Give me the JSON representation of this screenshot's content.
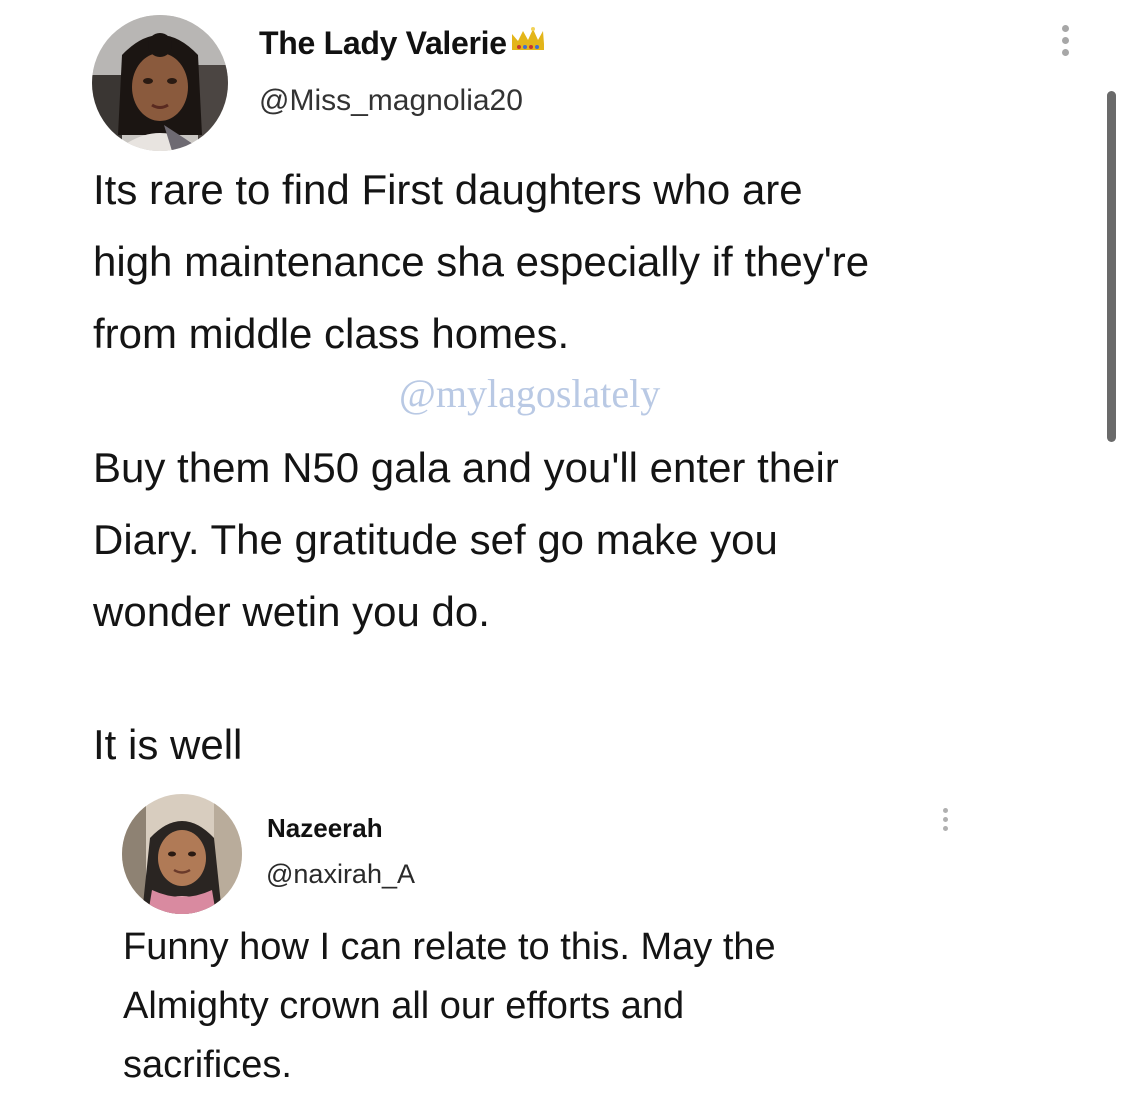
{
  "tweet": {
    "author": {
      "display_name": "The Lady Valerie",
      "badge_icon": "crown-icon",
      "handle": "@Miss_magnolia20"
    },
    "body": {
      "paragraph1": [
        "Its rare to find First daughters who are",
        "high maintenance sha especially if they're",
        "from middle class homes."
      ],
      "paragraph2": [
        "Buy them N50 gala and you'll enter their",
        "Diary. The gratitude sef go make you",
        "wonder wetin you do."
      ],
      "paragraph3": [
        "It is well"
      ]
    },
    "watermark": "@mylagoslately",
    "more_icon": "more-vertical-icon"
  },
  "reply": {
    "author": {
      "display_name": "Nazeerah",
      "handle": "@naxirah_A"
    },
    "body": [
      "Funny how I can relate to this. May the",
      "Almighty crown all our efforts and",
      "sacrifices."
    ],
    "more_icon": "more-vertical-icon"
  },
  "colors": {
    "background": "#ffffff",
    "text": "#141414",
    "watermark": "#b9c9e4",
    "crown": "#e3b51a",
    "scrollbar": "#6a6a6a"
  }
}
